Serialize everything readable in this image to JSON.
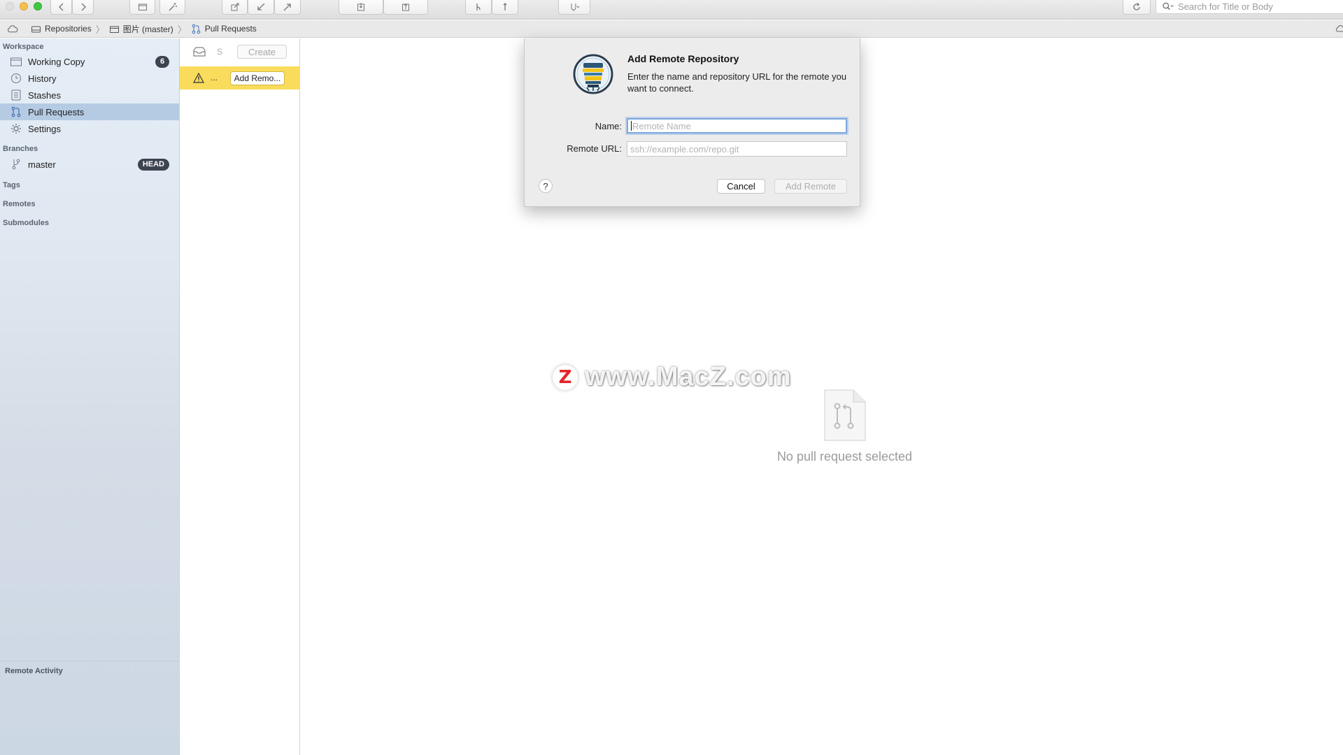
{
  "window": {
    "traffic_colors": {
      "close": "#e0e0e0",
      "minimize": "#f6be4f",
      "zoom": "#40c741"
    }
  },
  "toolbar": {
    "search_placeholder": "Search for Title or Body",
    "icons": [
      "back-icon",
      "forward-icon",
      "folder-icon",
      "wand-icon",
      "commit-icon",
      "pull-icon",
      "push-icon",
      "stash-icon",
      "unstash-icon",
      "branch-icon",
      "tag-icon",
      "merge-icon",
      "refresh-icon",
      "search-icon"
    ]
  },
  "pathbar": {
    "items": [
      {
        "label": "Repositories",
        "icon": "repositories-icon"
      },
      {
        "label": "图片 (master)",
        "icon": "folder-icon"
      },
      {
        "label": "Pull Requests",
        "icon": "pull-request-icon"
      }
    ]
  },
  "sidebar": {
    "workspace_header": "Workspace",
    "workspace_items": [
      {
        "label": "Working Copy",
        "icon": "folder-icon",
        "badge": "6"
      },
      {
        "label": "History",
        "icon": "clock-icon"
      },
      {
        "label": "Stashes",
        "icon": "stash-icon"
      },
      {
        "label": "Pull Requests",
        "icon": "pull-request-icon",
        "selected": true
      },
      {
        "label": "Settings",
        "icon": "gear-icon"
      }
    ],
    "branches_header": "Branches",
    "branches": [
      {
        "label": "master",
        "icon": "branch-icon",
        "badge": "HEAD"
      }
    ],
    "tags_header": "Tags",
    "remotes_header": "Remotes",
    "submodules_header": "Submodules",
    "remote_activity": "Remote Activity",
    "selected_color": "#b5cbe4"
  },
  "list": {
    "top_short": "S",
    "create_label": "Create",
    "warning_short": "...",
    "add_remote_label": "Add Remo...",
    "warning_color": "#f9dc5c"
  },
  "main": {
    "empty_text": "No pull request selected",
    "watermark": "www.MacZ.com",
    "watermark_logo": "Z"
  },
  "dialog": {
    "title": "Add Remote Repository",
    "message": "Enter the name and repository URL for the remote you want to connect.",
    "name_label": "Name:",
    "name_placeholder": "Remote Name",
    "url_label": "Remote URL:",
    "url_placeholder": "ssh://example.com/repo.git",
    "help_label": "?",
    "cancel_label": "Cancel",
    "add_label": "Add Remote",
    "focus_color": "#7ea7dc"
  }
}
